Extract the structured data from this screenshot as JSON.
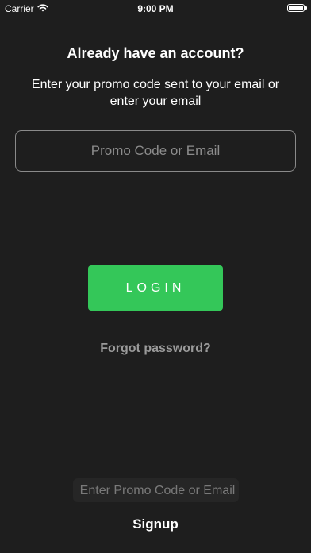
{
  "status_bar": {
    "carrier": "Carrier",
    "time": "9:00 PM",
    "wifi_icon": "wifi-icon",
    "battery_icon": "battery-icon"
  },
  "title": "Already have an account?",
  "subtitle": "Enter your promo code sent to your email or enter your email",
  "promo_input": {
    "placeholder": "Promo Code or Email",
    "value": ""
  },
  "login_button": {
    "label": "LOGIN"
  },
  "forgot_password": "Forgot password?",
  "bottom_input": {
    "placeholder": "Enter Promo Code or Email",
    "value": ""
  },
  "signup": "Signup",
  "colors": {
    "background": "#1e1e1e",
    "accent": "#34c759",
    "muted_text": "#9a9a9a"
  }
}
